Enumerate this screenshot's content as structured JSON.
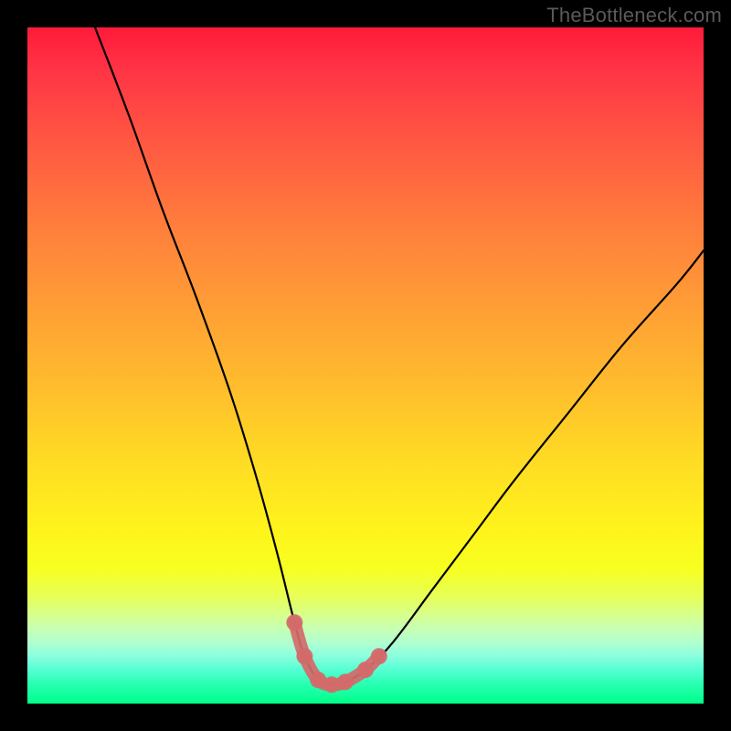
{
  "watermark": "TheBottleneck.com",
  "chart_data": {
    "type": "line",
    "title": "",
    "xlabel": "",
    "ylabel": "",
    "xlim": [
      0,
      100
    ],
    "ylim": [
      0,
      100
    ],
    "series": [
      {
        "name": "curve",
        "x": [
          10,
          15,
          20,
          25,
          30,
          34,
          37,
          39.5,
          41,
          43,
          45,
          47,
          50,
          54,
          60,
          66,
          72,
          80,
          88,
          96,
          100
        ],
        "y": [
          100,
          87,
          73,
          60,
          46,
          33,
          22,
          12,
          7,
          3.5,
          2.8,
          3.2,
          5,
          9,
          17,
          25,
          33,
          43,
          53,
          62,
          67
        ]
      },
      {
        "name": "highlight",
        "x": [
          39.5,
          41,
          43,
          45,
          47,
          50,
          52
        ],
        "y": [
          12,
          7,
          3.5,
          2.8,
          3.2,
          5,
          7
        ]
      }
    ],
    "gradient_stops": [
      {
        "pct": 0,
        "color": "#ff1a3a"
      },
      {
        "pct": 40,
        "color": "#ff9a36"
      },
      {
        "pct": 74,
        "color": "#fff31c"
      },
      {
        "pct": 100,
        "color": "#00ff88"
      }
    ]
  }
}
